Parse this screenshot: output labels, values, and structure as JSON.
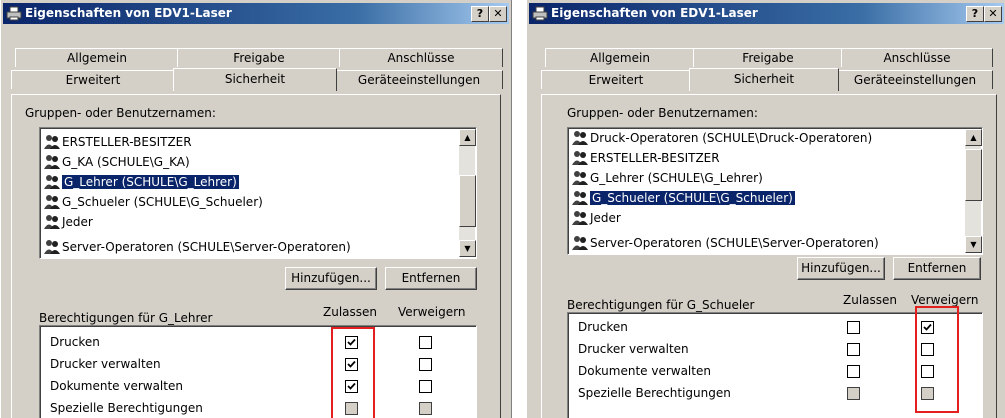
{
  "accent_color": "#0a246a",
  "highlight_color": "#e41f1f",
  "windows": [
    {
      "title": "Eigenschaften von EDV1-Laser",
      "title_icon": "printer-icon",
      "help_button": "?",
      "close_button": "✕",
      "tabs_row1": [
        {
          "label": "Allgemein"
        },
        {
          "label": "Freigabe"
        },
        {
          "label": "Anschlüsse"
        }
      ],
      "tabs_row2": [
        {
          "label": "Erweitert"
        },
        {
          "label": "Sicherheit"
        },
        {
          "label": "Geräteeinstellungen"
        }
      ],
      "active_tab": "Sicherheit",
      "groups_label": "Gruppen- oder Benutzernamen:",
      "users": [
        {
          "label": "ERSTELLER-BESITZER"
        },
        {
          "label": "G_KA (SCHULE\\G_KA)"
        },
        {
          "label": "G_Lehrer (SCHULE\\G_Lehrer)",
          "selected": true
        },
        {
          "label": "G_Schueler (SCHULE\\G_Schueler)"
        },
        {
          "label": "Jeder"
        },
        {
          "label": "Server-Operatoren (SCHULE\\Server-Operatoren)"
        }
      ],
      "add_button": "Hinzufügen...",
      "remove_button": "Entfernen",
      "perm_label": "Berechtigungen für G_Lehrer",
      "allow_header": "Zulassen",
      "deny_header": "Verweigern",
      "permissions": [
        {
          "name": "Drucken",
          "allow": true,
          "deny": false,
          "disabled": false
        },
        {
          "name": "Drucker verwalten",
          "allow": true,
          "deny": false,
          "disabled": false
        },
        {
          "name": "Dokumente verwalten",
          "allow": true,
          "deny": false,
          "disabled": false
        },
        {
          "name": "Spezielle Berechtigungen",
          "allow": false,
          "deny": false,
          "disabled": true
        }
      ]
    },
    {
      "title": "Eigenschaften von EDV1-Laser",
      "title_icon": "printer-icon",
      "help_button": "?",
      "close_button": "✕",
      "tabs_row1": [
        {
          "label": "Allgemein"
        },
        {
          "label": "Freigabe"
        },
        {
          "label": "Anschlüsse"
        }
      ],
      "tabs_row2": [
        {
          "label": "Erweitert"
        },
        {
          "label": "Sicherheit"
        },
        {
          "label": "Geräteeinstellungen"
        }
      ],
      "active_tab": "Sicherheit",
      "groups_label": "Gruppen- oder Benutzernamen:",
      "users": [
        {
          "label": "Druck-Operatoren (SCHULE\\Druck-Operatoren)"
        },
        {
          "label": "ERSTELLER-BESITZER"
        },
        {
          "label": "G_Lehrer (SCHULE\\G_Lehrer)"
        },
        {
          "label": "G_Schueler (SCHULE\\G_Schueler)",
          "selected": true
        },
        {
          "label": "Jeder"
        },
        {
          "label": "Server-Operatoren (SCHULE\\Server-Operatoren)"
        }
      ],
      "add_button": "Hinzufügen...",
      "remove_button": "Entfernen",
      "perm_label": "Berechtigungen für G_Schueler",
      "allow_header": "Zulassen",
      "deny_header": "Verweigern",
      "permissions": [
        {
          "name": "Drucken",
          "allow": false,
          "deny": true,
          "disabled": false
        },
        {
          "name": "Drucker verwalten",
          "allow": false,
          "deny": false,
          "disabled": false
        },
        {
          "name": "Dokumente verwalten",
          "allow": false,
          "deny": false,
          "disabled": false
        },
        {
          "name": "Spezielle Berechtigungen",
          "allow": false,
          "deny": false,
          "disabled": true
        }
      ]
    }
  ]
}
